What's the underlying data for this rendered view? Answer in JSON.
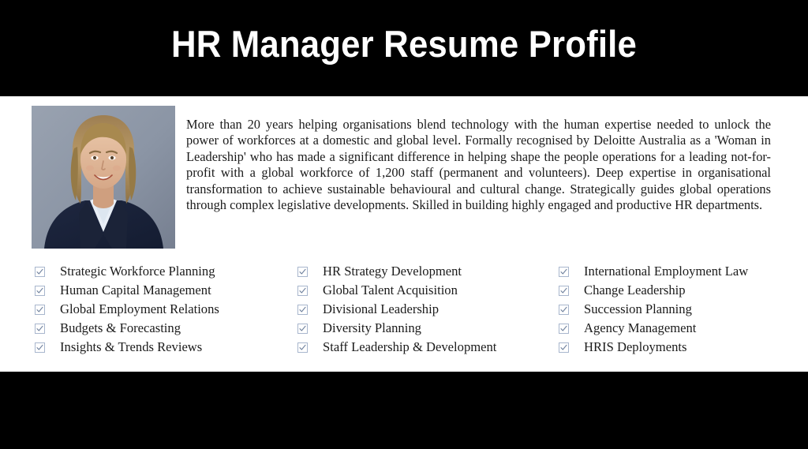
{
  "header": {
    "title": "HR Manager Resume Profile"
  },
  "profile": {
    "photo_alt": "headshot-photo",
    "summary": "More than 20 years helping organisations blend technology with the human expertise needed to unlock the power of workforces at a domestic and global level. Formally recognised by Deloitte Australia as a 'Woman in Leadership' who has made a significant difference in helping shape the people operations for a leading not-for-profit with a global workforce of 1,200 staff (permanent and volunteers). Deep expertise in organisational transformation to achieve sustainable behavioural and cultural change. Strategically guides global operations through complex legislative developments. Skilled in building highly engaged and productive HR departments."
  },
  "skills": {
    "checkbox_icon": "checkbox-checked-icon",
    "columns": [
      {
        "items": [
          "Strategic Workforce Planning",
          "Human Capital Management",
          "Global Employment Relations",
          "Budgets & Forecasting",
          "Insights & Trends Reviews"
        ]
      },
      {
        "items": [
          "HR Strategy Development",
          "Global Talent Acquisition",
          "Divisional Leadership",
          "Diversity Planning",
          "Staff Leadership & Development"
        ]
      },
      {
        "items": [
          "International Employment Law",
          "Change Leadership",
          "Succession Planning",
          "Agency Management",
          "HRIS Deployments"
        ]
      }
    ]
  },
  "colors": {
    "band": "#000000",
    "page": "#ffffff",
    "text": "#1b1b1b",
    "checkbox_border": "#a8b6cd",
    "checkbox_check": "#6d7f9c"
  }
}
